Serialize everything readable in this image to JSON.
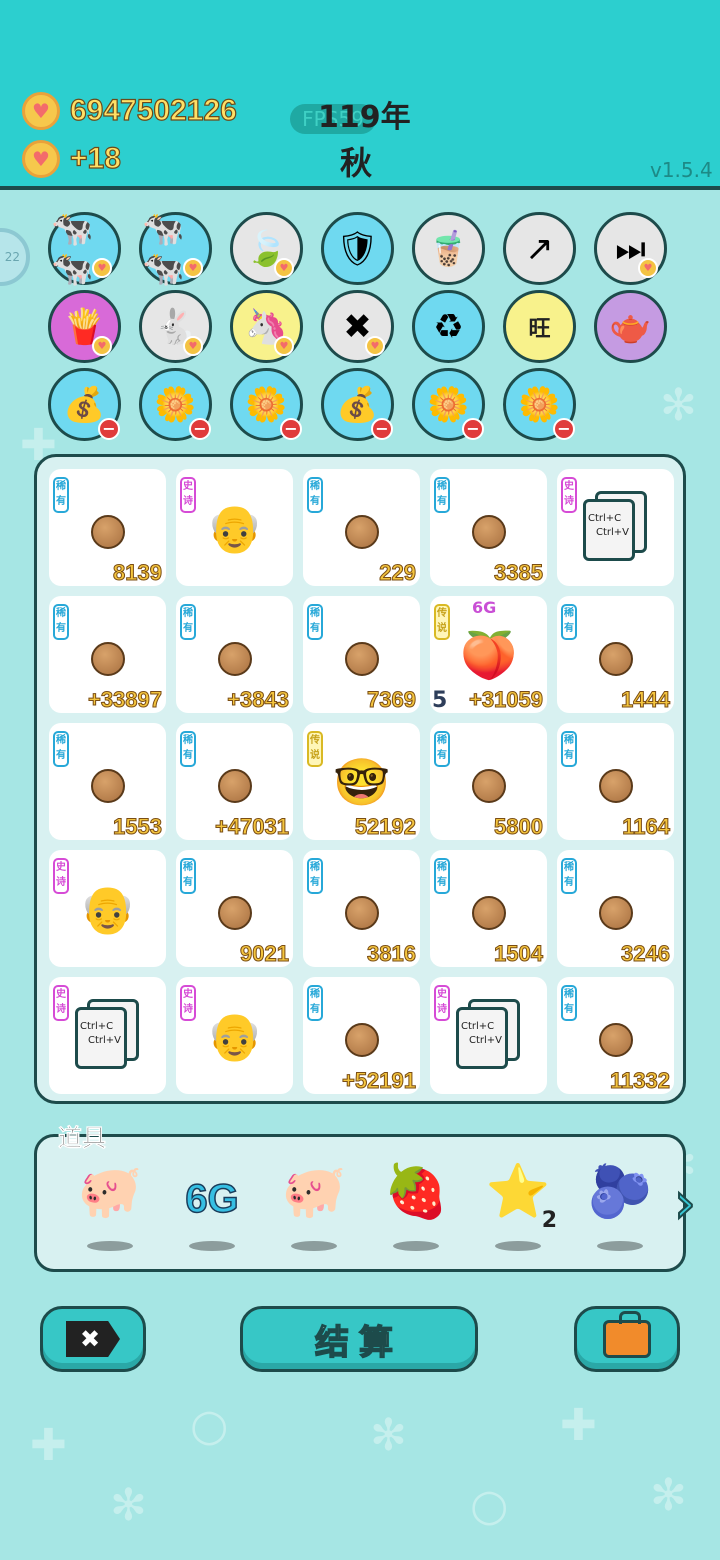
{
  "header": {
    "coins": "6947502126",
    "income": "+18",
    "fps": "FPS59",
    "year": "119年",
    "season": "秋",
    "version": "v1.5.4"
  },
  "side_circle_text": "22",
  "icons": {
    "row1": [
      {
        "name": "two-cows-icon",
        "glyph": "🐄🐄",
        "color": "blue",
        "badge": "heart"
      },
      {
        "name": "two-cows-icon-2",
        "glyph": "🐄🐄",
        "color": "blue",
        "badge": "heart"
      },
      {
        "name": "leaf-icon",
        "glyph": "🍃",
        "color": "gray",
        "badge": "heart"
      },
      {
        "name": "shield-wrench-icon",
        "glyph": "🛡",
        "color": "blue",
        "badge": ""
      },
      {
        "name": "bubble-tea-icon",
        "glyph": "🧋",
        "color": "gray",
        "badge": ""
      },
      {
        "name": "arrow-up-icon",
        "glyph": "↗",
        "color": "gray",
        "badge": ""
      },
      {
        "name": "skip-icon",
        "glyph": "⏭",
        "color": "gray",
        "badge": "heart"
      }
    ],
    "row2": [
      {
        "name": "fries-icon",
        "glyph": "🍟",
        "color": "pink",
        "badge": "heart"
      },
      {
        "name": "rabbit-icon",
        "glyph": "🐇",
        "color": "gray",
        "badge": "heart"
      },
      {
        "name": "unicorn-icon",
        "glyph": "🦄",
        "color": "yellow",
        "badge": "heart"
      },
      {
        "name": "delete-tag-icon",
        "glyph": "✖",
        "color": "gray",
        "badge": "heart"
      },
      {
        "name": "recycle-bag-icon",
        "glyph": "♻",
        "color": "blue",
        "badge": ""
      },
      {
        "name": "wang-tiles-icon",
        "text": "旺",
        "color": "yellow",
        "badge": ""
      },
      {
        "name": "gravy-boat-icon",
        "glyph": "🫖",
        "color": "purple",
        "badge": ""
      }
    ],
    "row3": [
      {
        "name": "sack-icon",
        "glyph": "💰",
        "color": "blue",
        "badge": "minus"
      },
      {
        "name": "potted-flower-icon",
        "glyph": "🌼",
        "color": "blue",
        "badge": "minus"
      },
      {
        "name": "potted-flower-icon-2",
        "glyph": "🌼",
        "color": "blue",
        "badge": "minus"
      },
      {
        "name": "sack-icon-2",
        "glyph": "💰",
        "color": "blue",
        "badge": "minus"
      },
      {
        "name": "potted-flower-icon-3",
        "glyph": "🌼",
        "color": "blue",
        "badge": "minus"
      },
      {
        "name": "potted-flower-icon-4",
        "glyph": "🌼",
        "color": "blue",
        "badge": "minus"
      }
    ]
  },
  "rarity_labels": {
    "rare": "稀有",
    "epic": "史诗",
    "legend": "传说"
  },
  "board": [
    {
      "kind": "coin",
      "rarity": "rare",
      "value": "8139"
    },
    {
      "kind": "farmer",
      "rarity": "epic",
      "value": ""
    },
    {
      "kind": "coin",
      "rarity": "rare",
      "value": "229"
    },
    {
      "kind": "coin",
      "rarity": "rare",
      "value": "3385"
    },
    {
      "kind": "paper",
      "rarity": "epic",
      "value": ""
    },
    {
      "kind": "coin",
      "rarity": "rare",
      "value": "+33897"
    },
    {
      "kind": "coin",
      "rarity": "rare",
      "value": "+3843"
    },
    {
      "kind": "coin",
      "rarity": "rare",
      "value": "7369"
    },
    {
      "kind": "peach",
      "rarity": "legend",
      "value": "+31059",
      "level": "5",
      "sixg": "6G"
    },
    {
      "kind": "coin",
      "rarity": "rare",
      "value": "1444"
    },
    {
      "kind": "coin",
      "rarity": "rare",
      "value": "1553"
    },
    {
      "kind": "coin",
      "rarity": "rare",
      "value": "+47031"
    },
    {
      "kind": "oldman",
      "rarity": "legend",
      "value": "52192"
    },
    {
      "kind": "coin",
      "rarity": "rare",
      "value": "5800"
    },
    {
      "kind": "coin",
      "rarity": "rare",
      "value": "1164"
    },
    {
      "kind": "farmer",
      "rarity": "epic",
      "value": ""
    },
    {
      "kind": "coin",
      "rarity": "rare",
      "value": "9021"
    },
    {
      "kind": "coin",
      "rarity": "rare",
      "value": "3816"
    },
    {
      "kind": "coin",
      "rarity": "rare",
      "value": "1504"
    },
    {
      "kind": "coin",
      "rarity": "rare",
      "value": "3246"
    },
    {
      "kind": "paper",
      "rarity": "epic",
      "value": ""
    },
    {
      "kind": "farmer",
      "rarity": "epic",
      "value": ""
    },
    {
      "kind": "coin",
      "rarity": "rare",
      "value": "+52191"
    },
    {
      "kind": "paper",
      "rarity": "epic",
      "value": ""
    },
    {
      "kind": "coin",
      "rarity": "rare",
      "value": "11332"
    }
  ],
  "paper_text": {
    "line1": "Ctrl+C",
    "line2": "Ctrl+V"
  },
  "items_label": "道具",
  "items": [
    {
      "name": "piggy-bank-icon",
      "glyph": "🐖",
      "count": ""
    },
    {
      "name": "6g-icon",
      "text": "6G",
      "count": ""
    },
    {
      "name": "piggy-bank-icon-2",
      "glyph": "🐖",
      "count": ""
    },
    {
      "name": "strawberry-icon",
      "glyph": "🍓",
      "count": ""
    },
    {
      "name": "star-icon",
      "glyph": "⭐",
      "count": "2"
    },
    {
      "name": "blueberry-icon",
      "glyph": "🫐",
      "count": ""
    }
  ],
  "buttons": {
    "close_icon": "✖",
    "settle": "结算",
    "next_arrow": "›"
  },
  "colors": {
    "background": "#a6e6e4",
    "header": "#2ccfcf",
    "button": "#37c7c6",
    "coin_text": "#f4c53e"
  }
}
